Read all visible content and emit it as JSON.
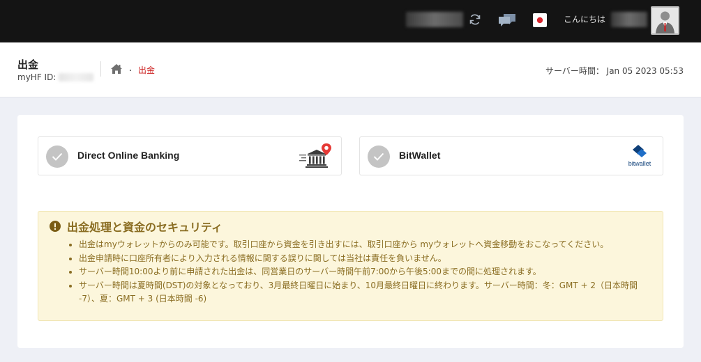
{
  "topbar": {
    "greeting": "こんにちは",
    "icons": [
      "refresh-icon",
      "chat-icon",
      "japan-flag-icon",
      "user-avatar"
    ],
    "colors": {
      "background": "#141414",
      "icon": "#aab4c0",
      "flag_red": "#d8242c"
    }
  },
  "header": {
    "title": "出金",
    "myhf_label": "myHF ID:",
    "breadcrumb": {
      "home_icon": "home-icon",
      "separator": "・",
      "current": "出金"
    },
    "server_time_label": "サーバー時間：",
    "server_time_value": "Jan 05 2023 05:53"
  },
  "methods": [
    {
      "label": "Direct Online Banking",
      "icon": "bank-location-icon"
    },
    {
      "label": "BitWallet",
      "icon": "bitwallet-logo",
      "logo_text": "bitwallet"
    }
  ],
  "notice": {
    "title": "出金処理と資金のセキュリティ",
    "items": [
      "出金はmyウォレットからのみ可能です。取引口座から資金を引き出すには、取引口座から myウォレットへ資金移動をおこなってください。",
      "出金申請時に口座所有者により入力される情報に関する誤りに関しては当社は責任を負いません。",
      "サーバー時間10:00より前に申請された出金は、同営業日のサーバー時間午前7:00から午後5:00までの間に処理されます。",
      "サーバー時間は夏時間(DST)の対象となっており、3月最終日曜日に始まり、10月最終日曜日に終わります。サーバー時間：冬：GMT + 2（日本時間 -7）、夏：GMT + 3 (日本時間 -6)"
    ],
    "colors": {
      "background": "#fcf6dc",
      "text": "#8a6d22"
    }
  },
  "accent_color": "#cc1f1f"
}
